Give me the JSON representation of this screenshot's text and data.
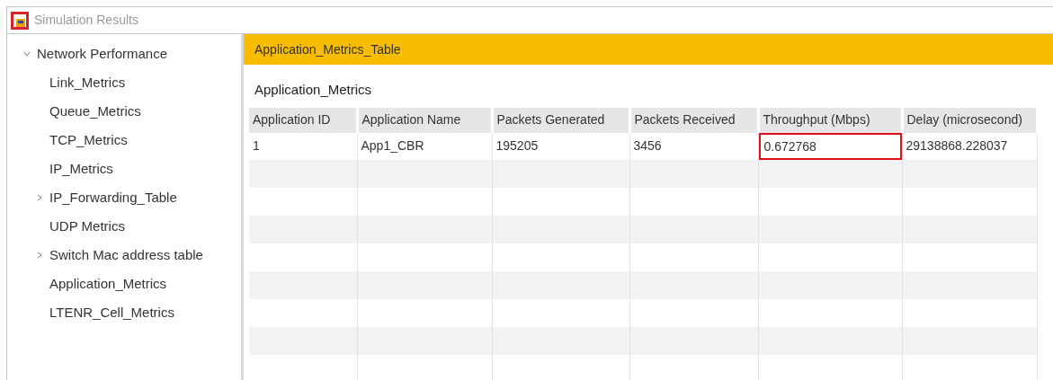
{
  "window": {
    "title": "Simulation Results"
  },
  "sidebar": {
    "items": [
      {
        "label": "Network Performance",
        "expanded": true,
        "children": [
          {
            "label": "Link_Metrics"
          },
          {
            "label": "Queue_Metrics"
          },
          {
            "label": "TCP_Metrics"
          },
          {
            "label": "IP_Metrics"
          },
          {
            "label": "IP_Forwarding_Table",
            "expanded": false
          },
          {
            "label": "UDP Metrics"
          },
          {
            "label": "Switch Mac address table",
            "expanded": false
          },
          {
            "label": "Application_Metrics"
          },
          {
            "label": "LTENR_Cell_Metrics"
          }
        ]
      }
    ]
  },
  "panel": {
    "header": "Application_Metrics_Table",
    "title": "Application_Metrics"
  },
  "table": {
    "columns": [
      "Application ID",
      "Application Name",
      "Packets Generated",
      "Packets Received",
      "Throughput (Mbps)",
      "Delay (microsecond)"
    ],
    "rows": [
      [
        {
          "text": "1",
          "highlighted": false
        },
        {
          "text": "App1_CBR",
          "highlighted": false
        },
        {
          "text": "195205",
          "highlighted": false
        },
        {
          "text": "3456",
          "highlighted": false
        },
        {
          "text": "0.672768",
          "highlighted": true
        },
        {
          "text": "29138868.228037",
          "highlighted": false
        }
      ]
    ]
  }
}
